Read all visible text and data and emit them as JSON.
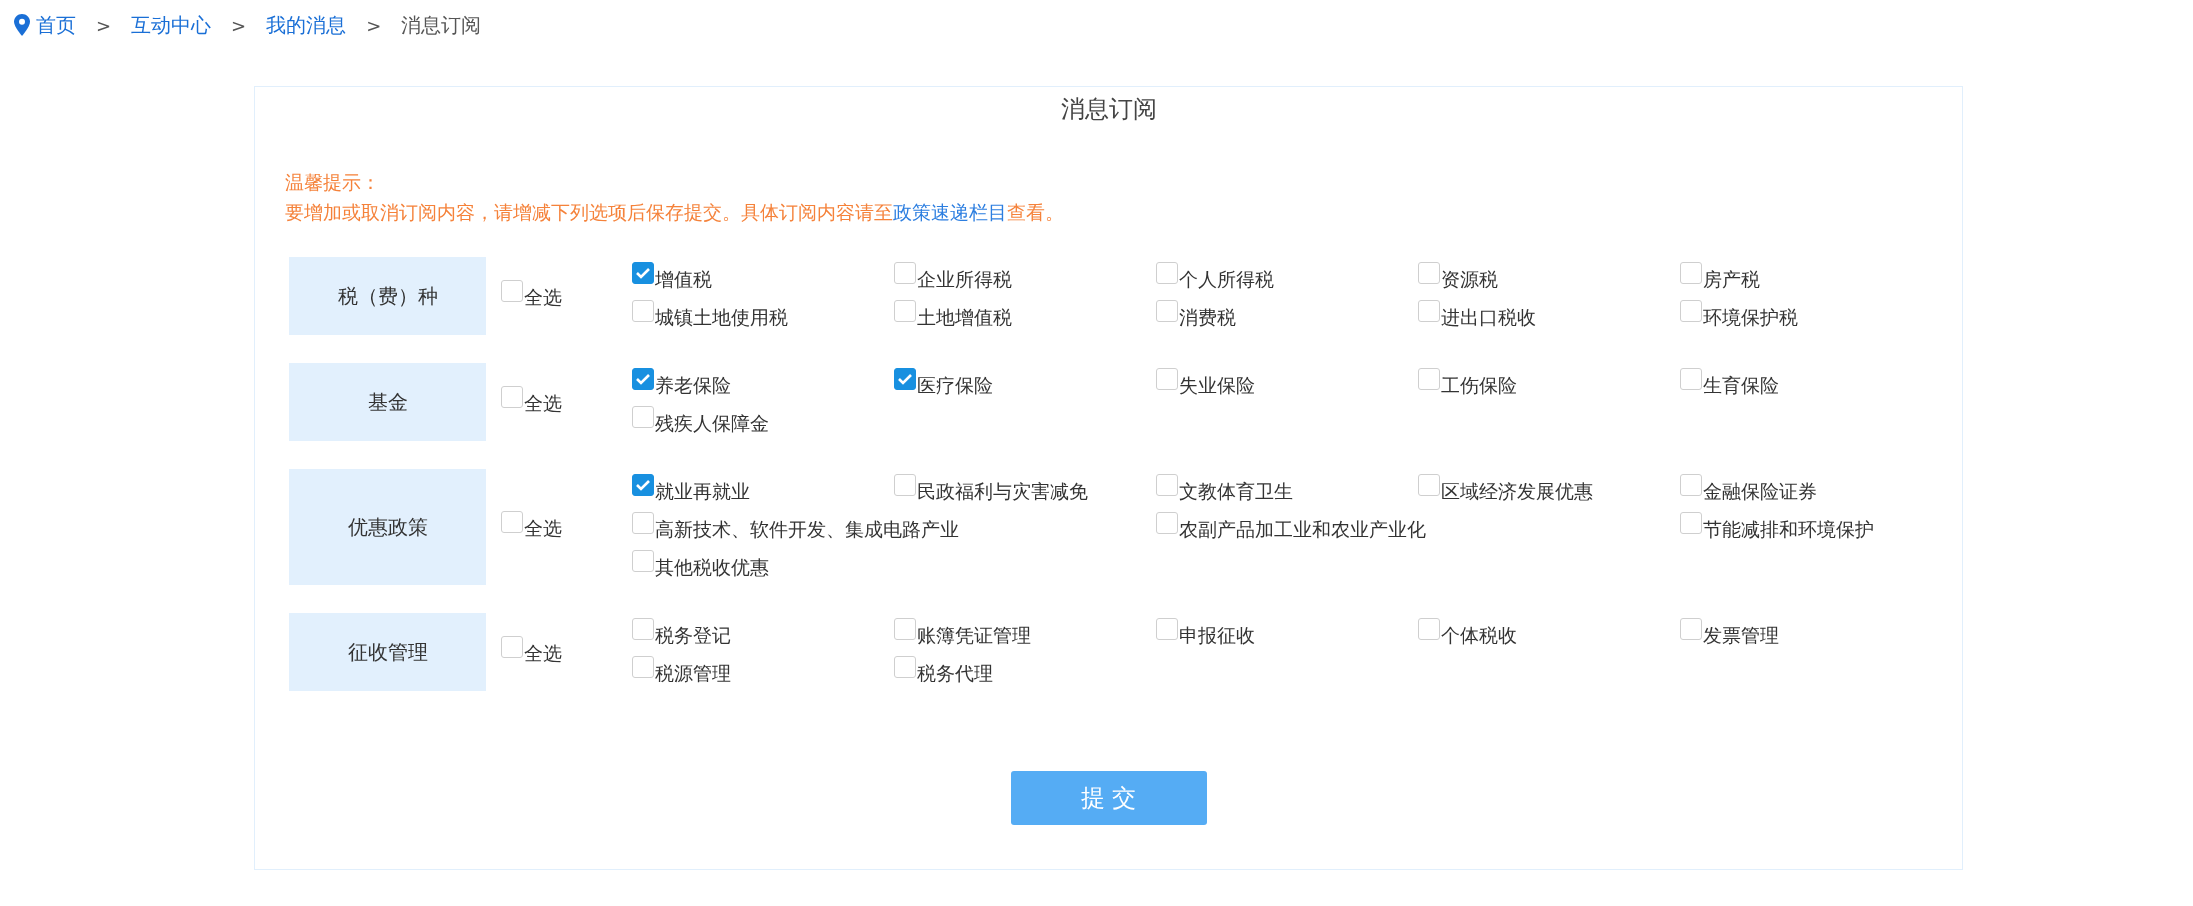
{
  "breadcrumb": [
    {
      "label": "首页",
      "current": false
    },
    {
      "label": "互动中心",
      "current": false
    },
    {
      "label": "我的消息",
      "current": false
    },
    {
      "label": "消息订阅",
      "current": true
    }
  ],
  "breadcrumb_separator": ">",
  "title": "消息订阅",
  "notice": {
    "heading": "温馨提示：",
    "before": "要增加或取消订阅内容，请增减下列选项后保存提交。具体订阅内容请至",
    "link": "政策速递栏目",
    "after": "查看。"
  },
  "groups": [
    {
      "label": "税（费）种",
      "select_all": {
        "label": "全选",
        "checked": false
      },
      "items": [
        {
          "label": "增值税",
          "checked": true
        },
        {
          "label": "企业所得税",
          "checked": false
        },
        {
          "label": "个人所得税",
          "checked": false
        },
        {
          "label": "资源税",
          "checked": false
        },
        {
          "label": "房产税",
          "checked": false
        },
        {
          "label": "城镇土地使用税",
          "checked": false
        },
        {
          "label": "土地增值税",
          "checked": false
        },
        {
          "label": "消费税",
          "checked": false
        },
        {
          "label": "进出口税收",
          "checked": false
        },
        {
          "label": "环境保护税",
          "checked": false
        }
      ]
    },
    {
      "label": "基金",
      "select_all": {
        "label": "全选",
        "checked": false
      },
      "items": [
        {
          "label": "养老保险",
          "checked": true
        },
        {
          "label": "医疗保险",
          "checked": true
        },
        {
          "label": "失业保险",
          "checked": false
        },
        {
          "label": "工伤保险",
          "checked": false
        },
        {
          "label": "生育保险",
          "checked": false
        },
        {
          "label": "残疾人保障金",
          "checked": false
        }
      ]
    },
    {
      "label": "优惠政策",
      "select_all": {
        "label": "全选",
        "checked": false
      },
      "items": [
        {
          "label": "就业再就业",
          "checked": true
        },
        {
          "label": "民政福利与灾害减免",
          "checked": false
        },
        {
          "label": "文教体育卫生",
          "checked": false
        },
        {
          "label": "区域经济发展优惠",
          "checked": false
        },
        {
          "label": "金融保险证券",
          "checked": false
        },
        {
          "label": "高新技术、软件开发、集成电路产业",
          "checked": false
        },
        {
          "label": "农副产品加工业和农业产业化",
          "checked": false
        },
        {
          "label": "节能减排和环境保护",
          "checked": false
        },
        {
          "label": "其他税收优惠",
          "checked": false
        }
      ]
    },
    {
      "label": "征收管理",
      "select_all": {
        "label": "全选",
        "checked": false
      },
      "items": [
        {
          "label": "税务登记",
          "checked": false
        },
        {
          "label": "账簿凭证管理",
          "checked": false
        },
        {
          "label": "申报征收",
          "checked": false
        },
        {
          "label": "个体税收",
          "checked": false
        },
        {
          "label": "发票管理",
          "checked": false
        },
        {
          "label": "税源管理",
          "checked": false
        },
        {
          "label": "税务代理",
          "checked": false
        }
      ]
    }
  ],
  "submit": "提 交"
}
